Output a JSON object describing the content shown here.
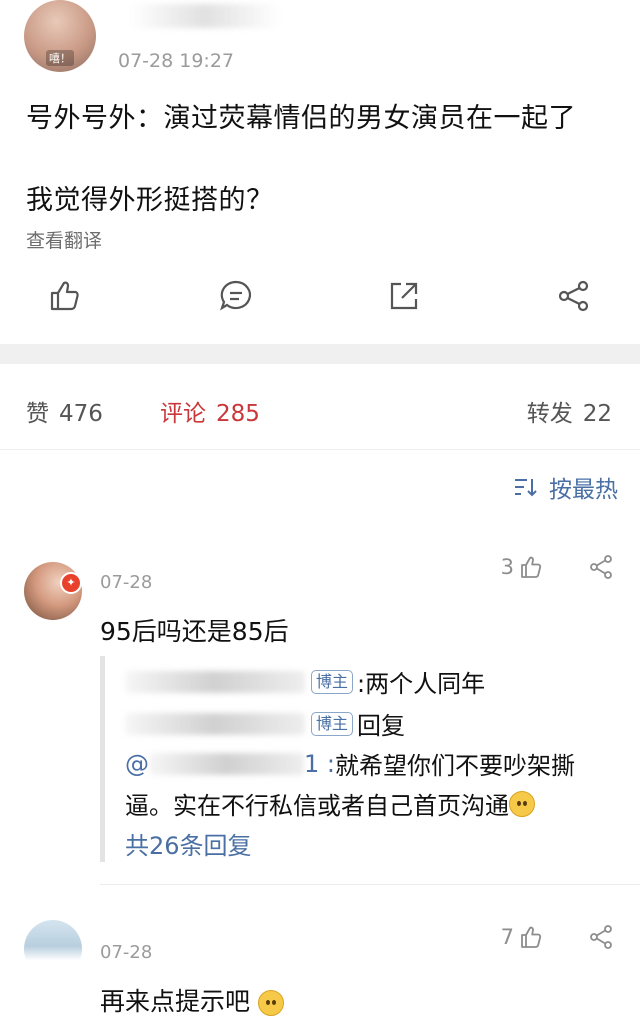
{
  "post": {
    "avatar_mark": "嘻！",
    "time": "07-28 19:27",
    "line1": "号外号外：演过荧幕情侣的男女演员在一起了",
    "line2": "我觉得外形挺搭的？",
    "translate_label": "查看翻译"
  },
  "actions": {
    "like_icon": "thumbs-up-icon",
    "comment_icon": "comment-bubble-icon",
    "share_icon": "repost-icon",
    "more_icon": "share-nodes-icon"
  },
  "stats": {
    "like_label": "赞",
    "like_count": "476",
    "comment_label": "评论",
    "comment_count": "285",
    "repost_label": "转发",
    "repost_count": "22"
  },
  "sort": {
    "label": "按最热"
  },
  "comments": [
    {
      "date": "07-28",
      "likes": "3",
      "text": "95后吗还是85后",
      "badge": "✦",
      "replies": [
        {
          "tag": "博主",
          "text": ":两个人同年"
        },
        {
          "tag": "博主",
          "text": "回复"
        },
        {
          "prefix": "@",
          "suffix": "1 :",
          "text": "就希望你们不要吵架撕"
        }
      ],
      "reply_wrap": "逼。实在不行私信或者自己首页沟通",
      "more": "共26条回复"
    },
    {
      "date": "07-28",
      "likes": "7",
      "text": "再来点提示吧"
    }
  ],
  "colors": {
    "accent": "#c9373a",
    "link": "#4a6fa5",
    "muted": "#9b9b9b"
  }
}
